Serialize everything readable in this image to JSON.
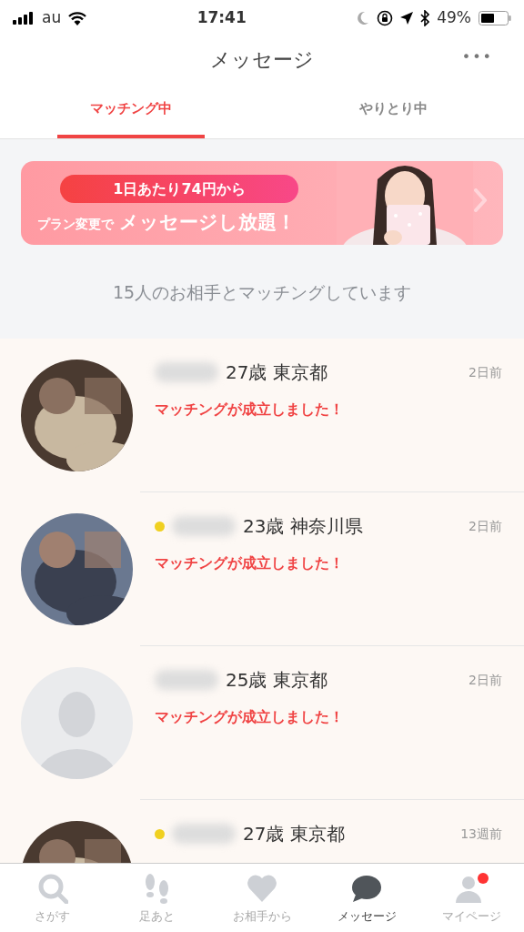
{
  "status_bar": {
    "carrier": "au",
    "time": "17:41",
    "battery": "49%"
  },
  "header": {
    "title": "メッセージ",
    "menu": "•••"
  },
  "tabs": [
    {
      "label": "マッチング中",
      "selected": true
    },
    {
      "label": "やりとり中",
      "selected": false
    }
  ],
  "banner": {
    "pill": "1日あたり74円から",
    "prefix": "プラン変更で",
    "highlight": "メッセージし放題！"
  },
  "match_count": "15人のお相手とマッチングしています",
  "matches": [
    {
      "online": false,
      "age_area": "27歳 東京都",
      "time": "2日前",
      "message": "マッチングが成立しました！"
    },
    {
      "online": true,
      "age_area": "23歳 神奈川県",
      "time": "2日前",
      "message": "マッチングが成立しました！"
    },
    {
      "kind": "placeholder",
      "online": false,
      "age_area": "25歳 東京都",
      "time": "2日前",
      "message": "マッチングが成立しました！"
    },
    {
      "online": true,
      "age_area": "27歳 東京都",
      "time": "13週前"
    }
  ],
  "bottom_nav": [
    {
      "kind": "search",
      "label": "さがす",
      "selected": false,
      "badge": false
    },
    {
      "kind": "footprints",
      "label": "足あと",
      "selected": false,
      "badge": false
    },
    {
      "kind": "heart",
      "label": "お相手から",
      "selected": false,
      "badge": false
    },
    {
      "kind": "chat",
      "label": "メッセージ",
      "selected": true,
      "badge": false
    },
    {
      "kind": "person",
      "label": "マイページ",
      "selected": false,
      "badge": true
    }
  ]
}
